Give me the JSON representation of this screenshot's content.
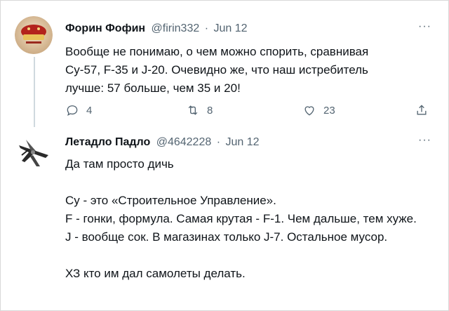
{
  "tweet1": {
    "author_name": "Форин Фофин",
    "handle": "@firin332",
    "separator": "·",
    "date": "Jun 12",
    "text_lines": [
      "Вообще не понимаю, о чем можно спорить, сравнивая",
      "Су-57, F-35 и J-20. Очевидно же, что наш истребитель",
      "лучше: 57 больше, чем 35 и 20!"
    ],
    "reply_count": "4",
    "retweet_count": "8",
    "like_count": "23",
    "more_label": "···"
  },
  "tweet2": {
    "author_name": "Летадло Падло",
    "handle": "@4642228",
    "separator": "·",
    "date": "Jun 12",
    "paragraphs": [
      "Да там просто дичь",
      "Су - это «Строительное Управление».",
      "F - гонки, формула. Самая крутая - F-1. Чем дальше, тем хуже.",
      "J - вообще сок. В магазинах только J-7. Остальное мусор.",
      "ХЗ кто им дал самолеты делать."
    ],
    "more_label": "···"
  },
  "colors": {
    "text": "#0f1419",
    "secondary": "#536471",
    "thread_line": "#cfd9de"
  },
  "icons": [
    "reply-icon",
    "retweet-icon",
    "like-icon",
    "share-icon",
    "more-icon"
  ]
}
